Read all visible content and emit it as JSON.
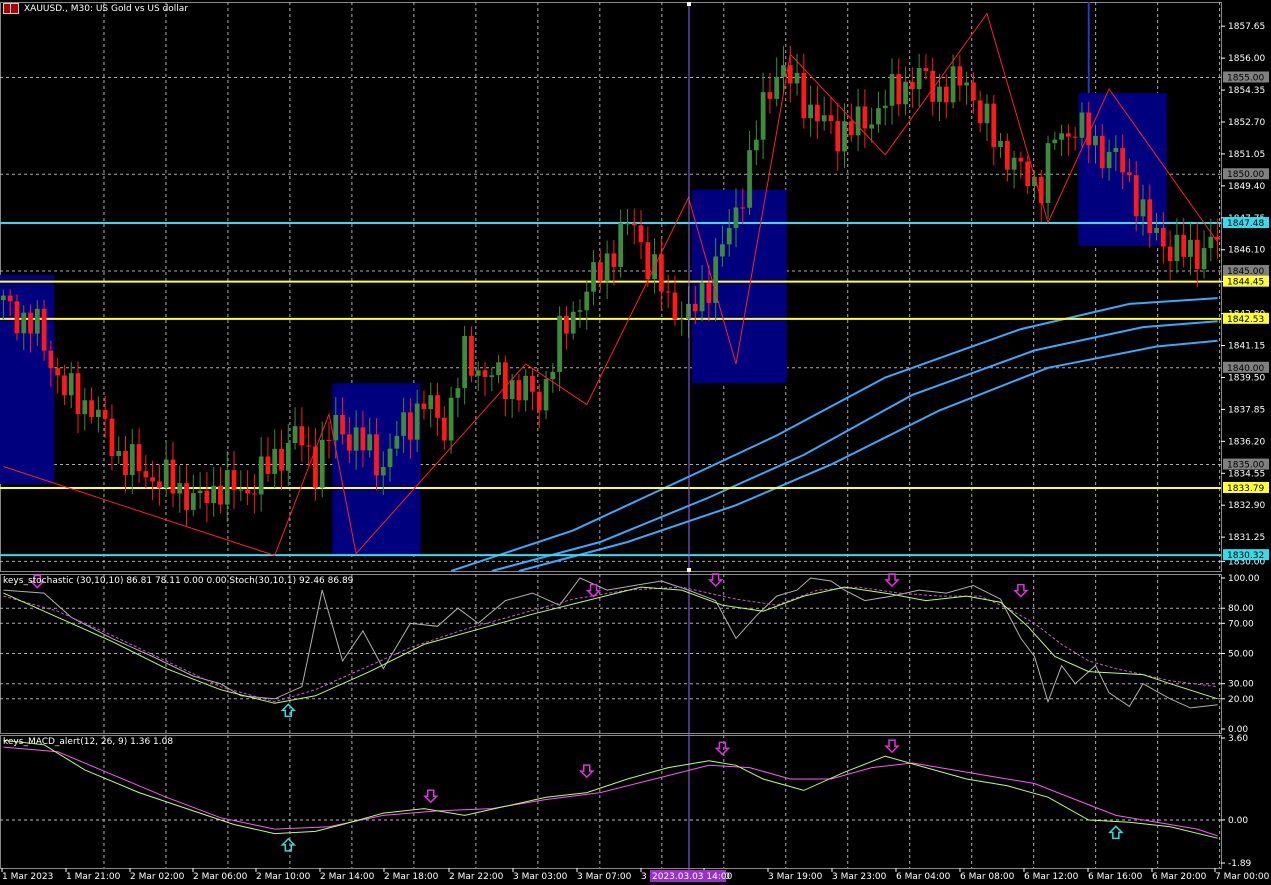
{
  "title": {
    "symbol": "XAUUSD.",
    "timeframe": "M30",
    "description": "US Gold vs US dollar",
    "text": "XAUUSD., M30:  US Gold vs US dollar"
  },
  "colors": {
    "background": "#000000",
    "bull": "#3c8c3c",
    "bear": "#ff1a1a",
    "zigzag": "#ff2020",
    "box": "#00007f",
    "ma": "#3aa8ff",
    "cyan_level": "#33ddee",
    "yellow_level": "#ffff33",
    "stoch_main": "#b0b0b0",
    "stoch_signal": "#cc55cc",
    "stoch_ma": "#b8ff70",
    "macd_main": "#b8ff70",
    "macd_signal": "#ff55ff",
    "arrow_down": "#dd33dd",
    "arrow_up": "#33dddd",
    "grid": "#c0c0c0",
    "vline": "#9966ff"
  },
  "price_axis": {
    "ticks": [
      "1857.65",
      "1856.00",
      "1854.35",
      "1852.70",
      "1851.05",
      "1849.40",
      "1847.75",
      "1846.10",
      "1844.45",
      "1842.80",
      "1841.15",
      "1839.50",
      "1837.85",
      "1836.20",
      "1834.55",
      "1832.90",
      "1831.25",
      "1830.00"
    ]
  },
  "price_tags": [
    {
      "text": "1855.00",
      "bg": "#808080",
      "fg": "#000000"
    },
    {
      "text": "1850.00",
      "bg": "#808080",
      "fg": "#000000"
    },
    {
      "text": "1847.48",
      "bg": "#33ddee",
      "fg": "#000000"
    },
    {
      "text": "1845.00",
      "bg": "#808080",
      "fg": "#000000"
    },
    {
      "text": "1844.45",
      "bg": "#ffff33",
      "fg": "#000000"
    },
    {
      "text": "1842.53",
      "bg": "#ffff33",
      "fg": "#000000"
    },
    {
      "text": "1840.00",
      "bg": "#808080",
      "fg": "#000000"
    },
    {
      "text": "1835.00",
      "bg": "#808080",
      "fg": "#000000"
    },
    {
      "text": "1833.79",
      "bg": "#ffff33",
      "fg": "#000000"
    },
    {
      "text": "1830.32",
      "bg": "#33ddee",
      "fg": "#000000"
    }
  ],
  "time_axis": {
    "labels": [
      "1 Mar 2023",
      "1 Mar 21:00",
      "2 Mar 02:00",
      "2 Mar 06:00",
      "2 Mar 10:00",
      "2 Mar 14:00",
      "2 Mar 18:00",
      "2 Mar 22:00",
      "3 Mar 03:00",
      "3 Mar 07:00",
      "3",
      "15:00",
      "3 Mar 19:00",
      "3 Mar 23:00",
      "6 Mar 04:00",
      "6 Mar 08:00",
      "6 Mar 12:00",
      "6 Mar 16:00",
      "6 Mar 20:00",
      "7 Mar 00:00"
    ],
    "highlight": "2023.03.03 14:00"
  },
  "stoch": {
    "label": "keys_stochastic (30,10,10) 86.81 78.11 0.00 0.00 Stoch(30,10,1) 92.46 86.89",
    "ticks": [
      "100.00",
      "80.00",
      "70.00",
      "50.00",
      "30.00",
      "20.00",
      "0.00"
    ]
  },
  "macd": {
    "label": "keys_MACD_alert(12, 26, 9) 1.36 1.08",
    "ticks": [
      "3.60",
      "0.00",
      "-1.89"
    ]
  },
  "chart_data": {
    "type": "candlestick",
    "title": "XAUUSD., M30:  US Gold vs US dollar",
    "ylim": [
      1829.5,
      1858.9
    ],
    "horizontal_levels": [
      {
        "value": 1847.48,
        "color": "cyan"
      },
      {
        "value": 1844.45,
        "color": "yellow"
      },
      {
        "value": 1842.53,
        "color": "yellow"
      },
      {
        "value": 1833.79,
        "color": "yellow"
      },
      {
        "value": 1830.32,
        "color": "cyan"
      }
    ],
    "price_path": [
      [
        0,
        1843.5
      ],
      [
        6,
        1842.0
      ],
      [
        10,
        1838.8
      ],
      [
        14,
        1838.0
      ],
      [
        18,
        1835.5
      ],
      [
        22,
        1834.5
      ],
      [
        26,
        1834.0
      ],
      [
        30,
        1833.0
      ],
      [
        33,
        1834.0
      ],
      [
        36,
        1833.5
      ],
      [
        40,
        1834.8
      ],
      [
        44,
        1836.5
      ],
      [
        47,
        1835.0
      ],
      [
        50,
        1837.0
      ],
      [
        53,
        1836.3
      ],
      [
        57,
        1835.0
      ],
      [
        60,
        1837.0
      ],
      [
        63,
        1838.2
      ],
      [
        66,
        1837.0
      ],
      [
        69,
        1840.5
      ],
      [
        73,
        1839.5
      ],
      [
        77,
        1839.0
      ],
      [
        80,
        1838.3
      ],
      [
        83,
        1841.5
      ],
      [
        86,
        1843.5
      ],
      [
        89,
        1845.0
      ],
      [
        92,
        1846.8
      ],
      [
        94,
        1847.5
      ],
      [
        96,
        1845.5
      ],
      [
        99,
        1843.5
      ],
      [
        102,
        1842.5
      ],
      [
        105,
        1844.5
      ],
      [
        108,
        1847.0
      ],
      [
        111,
        1850.5
      ],
      [
        113,
        1853.5
      ],
      [
        115,
        1855.5
      ],
      [
        117,
        1854.8
      ],
      [
        119,
        1854.0
      ],
      [
        121,
        1852.8
      ],
      [
        124,
        1852.2
      ],
      [
        127,
        1852.5
      ],
      [
        130,
        1853.3
      ],
      [
        133,
        1854.5
      ],
      [
        136,
        1855.0
      ],
      [
        139,
        1854.3
      ],
      [
        141,
        1854.5
      ],
      [
        143,
        1855.0
      ],
      [
        145,
        1853.0
      ],
      [
        148,
        1851.5
      ],
      [
        151,
        1850.0
      ],
      [
        154,
        1849.5
      ],
      [
        156,
        1851.8
      ],
      [
        159,
        1852.5
      ],
      [
        162,
        1851.5
      ],
      [
        165,
        1850.8
      ],
      [
        168,
        1849.0
      ],
      [
        170,
        1847.0
      ],
      [
        173,
        1846.3
      ],
      [
        176,
        1845.8
      ],
      [
        179,
        1846.5
      ]
    ],
    "zigzag": [
      [
        0,
        1834.9
      ],
      [
        40,
        1830.3
      ],
      [
        48,
        1837.6
      ],
      [
        52,
        1830.4
      ],
      [
        77,
        1840.2
      ],
      [
        86,
        1838.1
      ],
      [
        101,
        1848.8
      ],
      [
        108,
        1840.2
      ],
      [
        116,
        1856.2
      ],
      [
        130,
        1851.0
      ],
      [
        145,
        1858.3
      ],
      [
        154,
        1847.5
      ],
      [
        163,
        1854.4
      ],
      [
        179,
        1846.5
      ]
    ],
    "boxes": [
      {
        "from": 0,
        "to": 8,
        "low": 1834.0,
        "high": 1844.8
      },
      {
        "from": 49,
        "to": 62,
        "low": 1830.3,
        "high": 1839.2
      },
      {
        "from": 102,
        "to": 116,
        "low": 1839.2,
        "high": 1849.2
      },
      {
        "from": 159,
        "to": 172,
        "low": 1846.3,
        "high": 1854.2
      }
    ],
    "moving_averages": [
      {
        "name": "",
        "points": [
          [
            66,
            1829.5
          ],
          [
            84,
            1831.6
          ],
          [
            100,
            1834.2
          ],
          [
            114,
            1836.5
          ],
          [
            130,
            1839.5
          ],
          [
            150,
            1842.0
          ],
          [
            166,
            1843.3
          ],
          [
            179,
            1843.6
          ]
        ]
      },
      {
        "name": "",
        "points": [
          [
            72,
            1829.5
          ],
          [
            88,
            1831.0
          ],
          [
            104,
            1833.3
          ],
          [
            118,
            1835.5
          ],
          [
            134,
            1838.6
          ],
          [
            152,
            1840.9
          ],
          [
            168,
            1842.1
          ],
          [
            179,
            1842.4
          ]
        ]
      },
      {
        "name": "",
        "points": [
          [
            76,
            1829.5
          ],
          [
            92,
            1831.0
          ],
          [
            108,
            1832.9
          ],
          [
            122,
            1835.0
          ],
          [
            138,
            1837.8
          ],
          [
            154,
            1840.0
          ],
          [
            170,
            1841.1
          ],
          [
            179,
            1841.4
          ]
        ]
      }
    ],
    "stochastic": {
      "ylim": [
        0,
        100
      ],
      "main": [
        [
          0,
          92
        ],
        [
          6,
          90
        ],
        [
          10,
          74
        ],
        [
          16,
          60
        ],
        [
          22,
          48
        ],
        [
          28,
          35
        ],
        [
          32,
          30
        ],
        [
          35,
          22
        ],
        [
          40,
          20
        ],
        [
          44,
          28
        ],
        [
          47,
          92
        ],
        [
          50,
          45
        ],
        [
          53,
          65
        ],
        [
          56,
          40
        ],
        [
          60,
          70
        ],
        [
          64,
          68
        ],
        [
          67,
          80
        ],
        [
          70,
          70
        ],
        [
          74,
          85
        ],
        [
          78,
          90
        ],
        [
          82,
          82
        ],
        [
          85,
          100
        ],
        [
          89,
          92
        ],
        [
          93,
          95
        ],
        [
          97,
          98
        ],
        [
          101,
          92
        ],
        [
          105,
          85
        ],
        [
          108,
          60
        ],
        [
          111,
          75
        ],
        [
          114,
          88
        ],
        [
          117,
          92
        ],
        [
          119,
          100
        ],
        [
          122,
          98
        ],
        [
          124,
          92
        ],
        [
          127,
          85
        ],
        [
          131,
          88
        ],
        [
          135,
          92
        ],
        [
          139,
          90
        ],
        [
          143,
          95
        ],
        [
          147,
          86
        ],
        [
          150,
          60
        ],
        [
          152,
          48
        ],
        [
          154,
          18
        ],
        [
          156,
          42
        ],
        [
          158,
          30
        ],
        [
          161,
          42
        ],
        [
          163,
          24
        ],
        [
          166,
          15
        ],
        [
          168,
          30
        ],
        [
          172,
          20
        ],
        [
          175,
          14
        ],
        [
          179,
          16
        ]
      ],
      "signal": [
        [
          0,
          88
        ],
        [
          8,
          78
        ],
        [
          16,
          62
        ],
        [
          24,
          45
        ],
        [
          32,
          28
        ],
        [
          40,
          18
        ],
        [
          46,
          26
        ],
        [
          52,
          38
        ],
        [
          60,
          54
        ],
        [
          68,
          66
        ],
        [
          76,
          76
        ],
        [
          84,
          86
        ],
        [
          92,
          92
        ],
        [
          100,
          94
        ],
        [
          108,
          86
        ],
        [
          114,
          82
        ],
        [
          120,
          92
        ],
        [
          126,
          94
        ],
        [
          132,
          90
        ],
        [
          138,
          88
        ],
        [
          144,
          88
        ],
        [
          148,
          80
        ],
        [
          152,
          70
        ],
        [
          156,
          56
        ],
        [
          160,
          45
        ],
        [
          164,
          40
        ],
        [
          168,
          36
        ],
        [
          172,
          32
        ],
        [
          179,
          28
        ]
      ],
      "ma": [
        [
          0,
          90
        ],
        [
          8,
          74
        ],
        [
          16,
          58
        ],
        [
          24,
          40
        ],
        [
          32,
          26
        ],
        [
          40,
          17
        ],
        [
          46,
          22
        ],
        [
          54,
          38
        ],
        [
          62,
          56
        ],
        [
          70,
          66
        ],
        [
          78,
          76
        ],
        [
          86,
          85
        ],
        [
          94,
          94
        ],
        [
          100,
          92
        ],
        [
          106,
          82
        ],
        [
          112,
          78
        ],
        [
          118,
          88
        ],
        [
          124,
          94
        ],
        [
          130,
          90
        ],
        [
          136,
          85
        ],
        [
          142,
          88
        ],
        [
          147,
          84
        ],
        [
          151,
          68
        ],
        [
          155,
          48
        ],
        [
          160,
          38
        ],
        [
          164,
          37
        ],
        [
          168,
          36
        ],
        [
          172,
          30
        ],
        [
          179,
          20
        ]
      ]
    },
    "macd": {
      "ylim": [
        -1.89,
        3.6
      ],
      "main": [
        [
          0,
          3.5
        ],
        [
          6,
          3.3
        ],
        [
          12,
          2.2
        ],
        [
          20,
          1.2
        ],
        [
          28,
          0.4
        ],
        [
          34,
          -0.2
        ],
        [
          40,
          -0.6
        ],
        [
          46,
          -0.5
        ],
        [
          50,
          -0.2
        ],
        [
          56,
          0.3
        ],
        [
          62,
          0.5
        ],
        [
          68,
          0.2
        ],
        [
          74,
          0.6
        ],
        [
          80,
          1.0
        ],
        [
          86,
          1.2
        ],
        [
          92,
          1.8
        ],
        [
          98,
          2.3
        ],
        [
          104,
          2.6
        ],
        [
          108,
          2.4
        ],
        [
          112,
          1.8
        ],
        [
          118,
          1.3
        ],
        [
          124,
          2.1
        ],
        [
          130,
          2.8
        ],
        [
          136,
          2.3
        ],
        [
          142,
          1.8
        ],
        [
          148,
          1.5
        ],
        [
          154,
          1.0
        ],
        [
          160,
          0.0
        ],
        [
          166,
          -0.1
        ],
        [
          172,
          -0.3
        ],
        [
          179,
          -0.8
        ]
      ],
      "signal": [
        [
          0,
          3.2
        ],
        [
          8,
          3.0
        ],
        [
          16,
          2.0
        ],
        [
          24,
          1.0
        ],
        [
          32,
          0.1
        ],
        [
          40,
          -0.4
        ],
        [
          48,
          -0.3
        ],
        [
          56,
          0.2
        ],
        [
          64,
          0.4
        ],
        [
          72,
          0.5
        ],
        [
          80,
          0.9
        ],
        [
          88,
          1.2
        ],
        [
          96,
          1.8
        ],
        [
          104,
          2.4
        ],
        [
          110,
          2.3
        ],
        [
          116,
          1.8
        ],
        [
          122,
          1.8
        ],
        [
          128,
          2.3
        ],
        [
          134,
          2.5
        ],
        [
          140,
          2.2
        ],
        [
          146,
          1.9
        ],
        [
          152,
          1.6
        ],
        [
          158,
          0.9
        ],
        [
          164,
          0.2
        ],
        [
          170,
          -0.1
        ],
        [
          176,
          -0.4
        ],
        [
          179,
          -0.7
        ]
      ]
    }
  }
}
